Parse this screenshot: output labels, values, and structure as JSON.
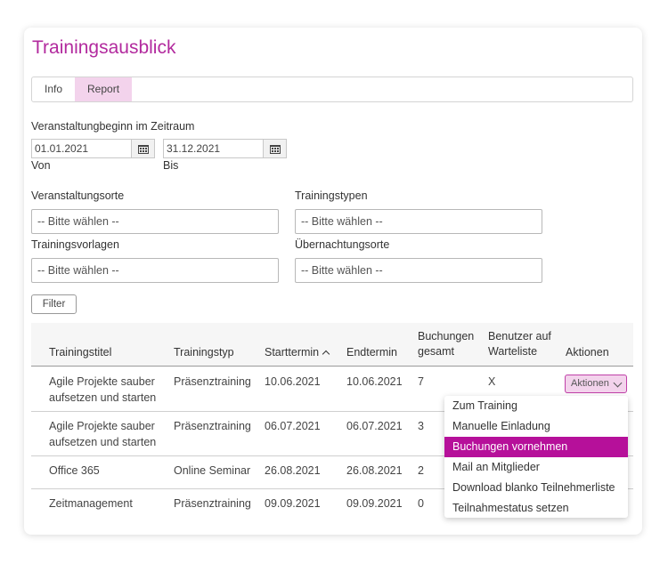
{
  "page": {
    "title": "Trainingsausblick"
  },
  "tabs": [
    {
      "label": "Info"
    },
    {
      "label": "Report"
    }
  ],
  "period": {
    "label": "Veranstaltungbeginn im Zeitraum",
    "from_value": "01.01.2021",
    "from_label": "Von",
    "to_value": "31.12.2021",
    "to_label": "Bis"
  },
  "filters": {
    "orte_label": "Veranstaltungsorte",
    "typen_label": "Trainingstypen",
    "vorlagen_label": "Trainingsvorlagen",
    "uebernachtung_label": "Übernachtungsorte",
    "placeholder": "-- Bitte wählen --",
    "filter_button": "Filter"
  },
  "table": {
    "headers": {
      "titel": "Trainingstitel",
      "typ": "Trainingstyp",
      "start": "Starttermin",
      "end": "Endtermin",
      "buchungen_1": "Buchungen",
      "buchungen_2": "gesamt",
      "warte_1": "Benutzer auf",
      "warte_2": "Warteliste",
      "aktionen": "Aktionen"
    },
    "rows": [
      {
        "titel_1": "Agile Projekte sauber",
        "titel_2": "aufsetzen und starten",
        "typ": "Präsenztraining",
        "start": "10.06.2021",
        "end": "10.06.2021",
        "buchungen": "7",
        "warte": "X"
      },
      {
        "titel_1": "Agile Projekte sauber",
        "titel_2": "aufsetzen und starten",
        "typ": "Präsenztraining",
        "start": "06.07.2021",
        "end": "06.07.2021",
        "buchungen": "3",
        "warte": ""
      },
      {
        "titel_1": "Office 365",
        "titel_2": "",
        "typ": "Online Seminar",
        "start": "26.08.2021",
        "end": "26.08.2021",
        "buchungen": "2",
        "warte": ""
      },
      {
        "titel_1": "Zeitmanagement",
        "titel_2": "",
        "typ": "Präsenztraining",
        "start": "09.09.2021",
        "end": "09.09.2021",
        "buchungen": "0",
        "warte": ""
      }
    ],
    "aktionen_button": "Aktionen"
  },
  "dropdown_menu": {
    "items": [
      "Zum Training",
      "Manuelle Einladung",
      "Buchungen vornehmen",
      "Mail an Mitglieder",
      "Download blanko Teilnehmerliste",
      "Teilnahmestatus setzen"
    ],
    "highlighted_index": 2
  },
  "icons": {
    "calendar": "calendar-icon",
    "sort": "sort-ascending-icon",
    "chevron": "chevron-down-icon"
  },
  "colors": {
    "accent": "#b22a9e",
    "tab_active": "#f3d3ec",
    "menu_highlight": "#b6109a"
  }
}
